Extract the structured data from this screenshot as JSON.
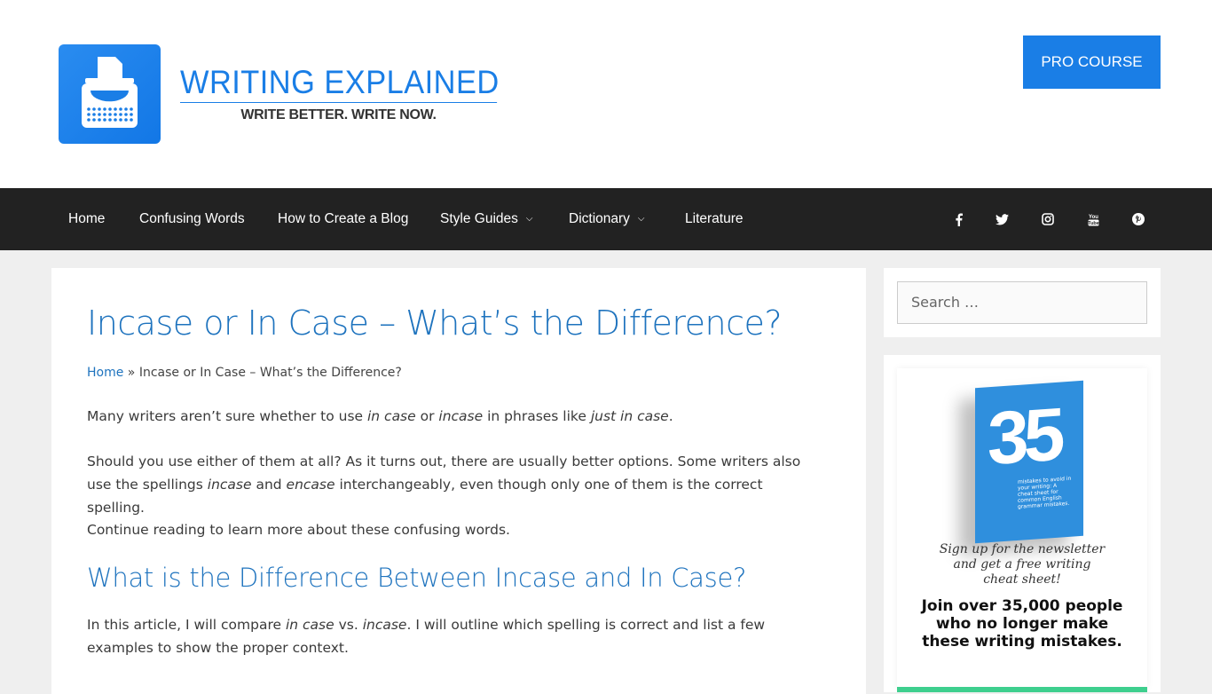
{
  "header": {
    "logo_title": "WRITING EXPLAINED",
    "logo_tagline": "WRITE BETTER. WRITE NOW.",
    "logo_icon": "typewriter-icon",
    "cta_button": "PRO COURSE",
    "accent_color": "#1a7ee6"
  },
  "nav": {
    "items": [
      {
        "label": "Home",
        "dropdown": false
      },
      {
        "label": "Confusing Words",
        "dropdown": false
      },
      {
        "label": "How to Create a Blog",
        "dropdown": false
      },
      {
        "label": "Style Guides",
        "dropdown": true
      },
      {
        "label": "Dictionary",
        "dropdown": true
      },
      {
        "label": "Literature",
        "dropdown": false
      }
    ],
    "chevron": "⌄",
    "social": [
      "facebook-icon",
      "twitter-icon",
      "instagram-icon",
      "youtube-icon",
      "pinterest-icon"
    ],
    "background": "#222222"
  },
  "article": {
    "title": "Incase or In Case – What’s the Difference?",
    "breadcrumb": {
      "home": "Home",
      "separator": " » ",
      "current": "Incase or In Case – What’s the Difference?"
    },
    "paragraphs": [
      {
        "html_parts": [
          "Many writers aren’t sure whether to use ",
          "in case",
          " or ",
          "incase",
          " in phrases like ",
          "just in case",
          "."
        ]
      },
      {
        "html_parts": [
          "Should you use either of them at all? As it turns out, there are usually better options. Some writers also use the spellings ",
          "incase",
          " and ",
          "encase",
          " interchangeably, even though only one of them is the correct spelling."
        ]
      },
      {
        "html_parts": [
          "Continue reading to learn more about these confusing words."
        ]
      }
    ],
    "subheading": "What is the Difference Between Incase and In Case?",
    "paragraph4": {
      "html_parts": [
        "In this article, I will compare ",
        "in case",
        " vs. ",
        "incase",
        ". I will outline which spelling is correct and list a few examples to show the proper context."
      ]
    },
    "title_color": "#1e73be"
  },
  "sidebar": {
    "search_placeholder": "Search …",
    "promo": {
      "book_number": "35",
      "book_text": "mistakes to avoid in your writing: A cheat sheet for common English grammar mistakes.",
      "signup_line1": "Sign up for the newsletter",
      "signup_line2": "and get a free writing",
      "signup_line3": "cheat sheet!",
      "join_line1": "Join over 35,000 people",
      "join_line2": "who no longer make",
      "join_line3": "these writing mistakes."
    }
  }
}
